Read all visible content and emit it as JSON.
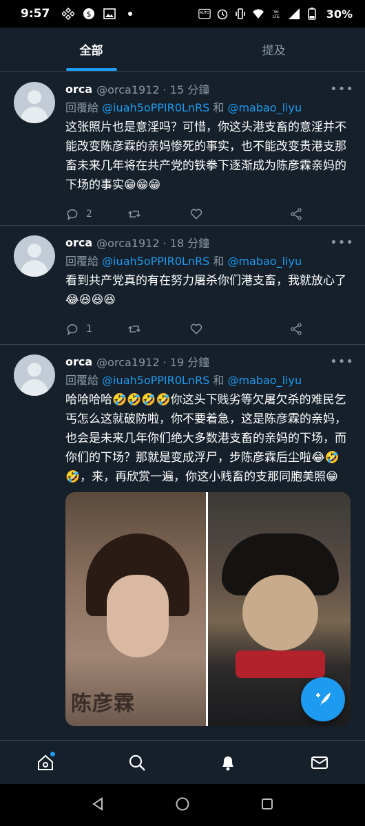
{
  "status_bar": {
    "time": "9:57",
    "battery": "30%"
  },
  "tabs": [
    {
      "label": "全部",
      "active": true
    },
    {
      "label": "提及",
      "active": false
    }
  ],
  "tweets": [
    {
      "name": "orca",
      "meta": "@orca1912 · 15 分鐘",
      "reply_prefix": "回覆給",
      "mention1": "@iuah5oPPIR0LnRS",
      "and": "和",
      "mention2": "@mabao_liyu",
      "text": "这张照片也是意淫吗？可惜，你这头港支畜的意淫并不能改变陈彦霖的亲妈惨死的事实，也不能改变贵港支那畜未来几年将在共产党的铁拳下逐渐成为陈彦霖亲妈的下场的事实😁😁😁",
      "replies": "2"
    },
    {
      "name": "orca",
      "meta": "@orca1912 · 18 分鐘",
      "reply_prefix": "回覆給",
      "mention1": "@iuah5oPPIR0LnRS",
      "and": "和",
      "mention2": "@mabao_liyu",
      "text": "看到共产党真的有在努力屠杀你们港支畜，我就放心了😂😆😆😆",
      "replies": "1"
    },
    {
      "name": "orca",
      "meta": "@orca1912 · 19 分鐘",
      "reply_prefix": "回覆給",
      "mention1": "@iuah5oPPIR0LnRS",
      "and": "和",
      "mention2": "@mabao_liyu",
      "text": "哈哈哈哈🤣🤣🤣🤣你这头下贱劣等欠屠欠杀的难民乞丐怎么这就破防啦，你不要着急，这是陈彦霖的亲妈，也会是未来几年你们绝大多数港支畜的亲妈的下场，而你们的下场？那就是变成浮尸，步陈彦霖后尘啦😂🤣🤣，来，再欣赏一遍，你这小贱畜的支那同胞美照😁",
      "image_caption": "陈彦霖"
    }
  ],
  "colors": {
    "background": "#15202b",
    "accent": "#1d9bf0",
    "secondary_text": "#8b98a5",
    "divider": "#38444d"
  },
  "icons": [
    "reply-icon",
    "retweet-icon",
    "like-icon",
    "share-icon",
    "more-icon",
    "home-icon",
    "search-icon",
    "notifications-icon",
    "messages-icon",
    "compose-icon",
    "back-icon",
    "home-circle-icon",
    "recents-icon"
  ]
}
